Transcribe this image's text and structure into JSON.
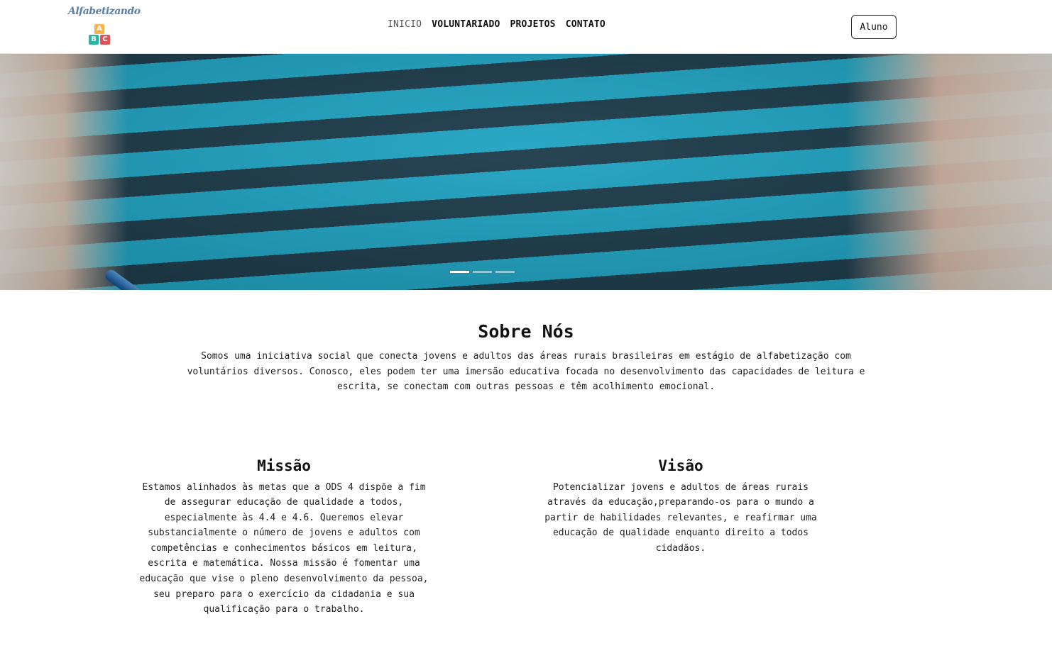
{
  "brand": {
    "name": "Alfabetizando",
    "blocks": [
      "A",
      "B",
      "C"
    ]
  },
  "nav": {
    "items": [
      "INICIO",
      "VOLUNTARIADO",
      "PROJETOS",
      "CONTATO"
    ],
    "login_label": "Aluno"
  },
  "hero": {
    "slide_count": 3,
    "active_slide": 1
  },
  "about": {
    "title": "Sobre Nós",
    "text": "Somos uma iniciativa social que conecta jovens e adultos das áreas rurais brasileiras em estágio de alfabetização com voluntários diversos. Conosco, eles podem ter uma imersão educativa focada no desenvolvimento das capacidades de leitura e escrita, se conectam com outras pessoas e têm acolhimento emocional."
  },
  "mission": {
    "title": "Missão",
    "text": "Estamos alinhados às metas que a ODS 4 dispõe a fim de assegurar educação de qualidade a todos, especialmente às 4.4 e 4.6. Queremos elevar substancialmente o número de jovens e adultos com competências e conhecimentos básicos em leitura, escrita e matemática. Nossa missão é fomentar uma educação que vise o pleno desenvolvimento da pessoa, seu preparo para o exercício da cidadania e sua qualificação para o trabalho."
  },
  "vision": {
    "title": "Visão",
    "text": "Potencializar jovens e adultos de áreas rurais através da educação,preparando-os para o mundo a partir de habilidades relevantes, e reafirmar uma educação de qualidade enquanto direito a todos cidadãos."
  }
}
